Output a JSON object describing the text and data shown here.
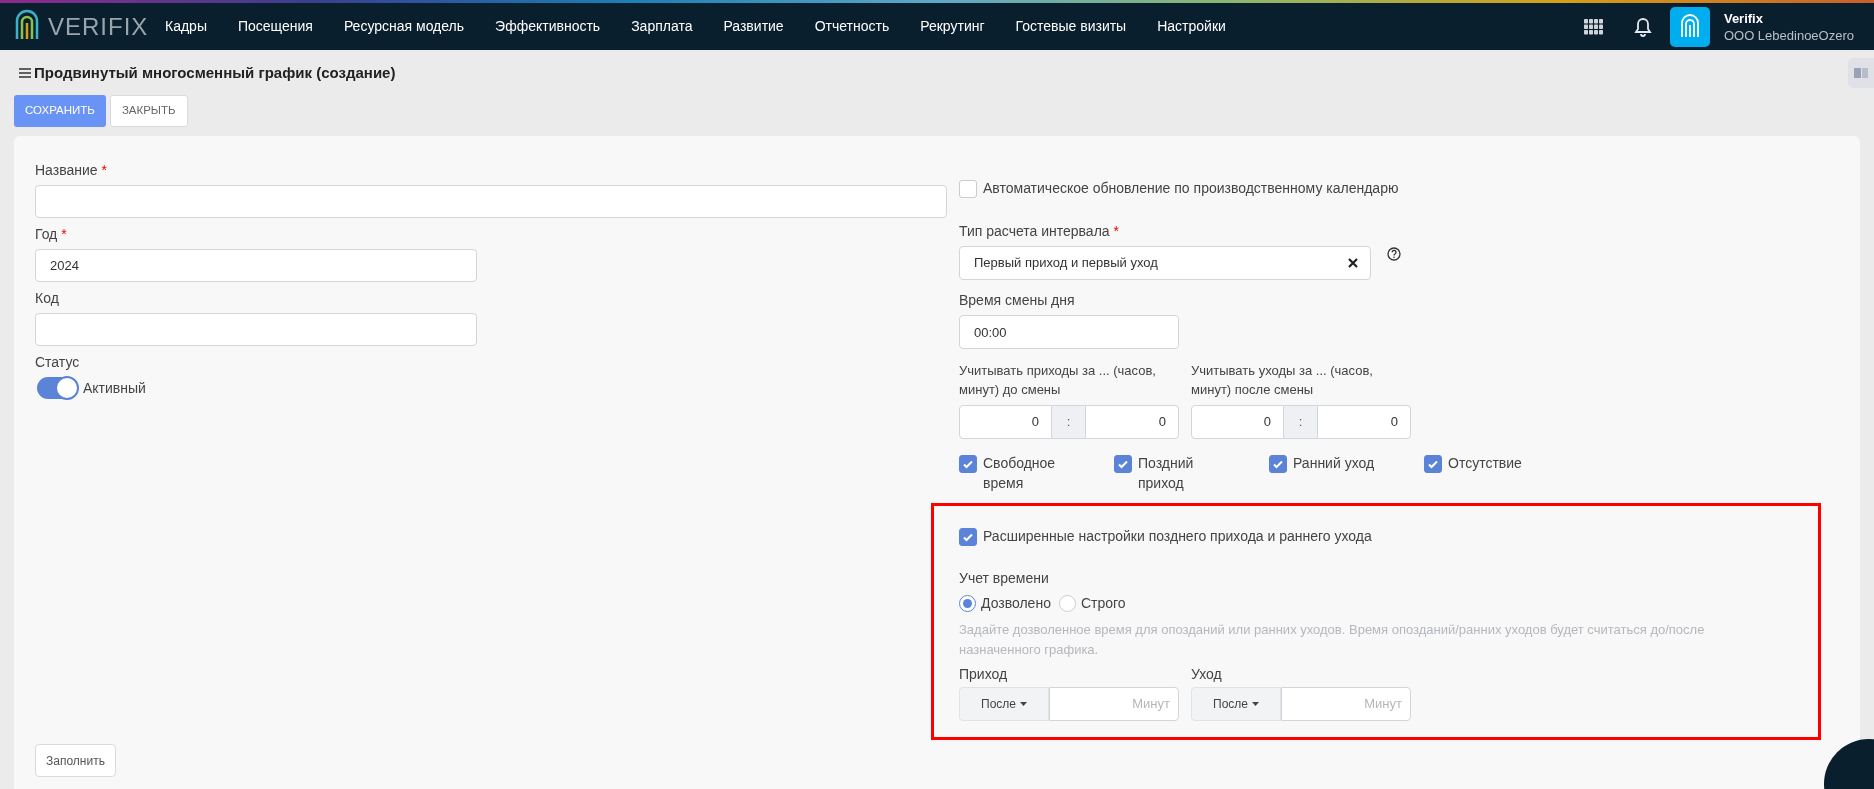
{
  "nav": {
    "logo": "VERIFIX",
    "menu": [
      "Кадры",
      "Посещения",
      "Ресурсная модель",
      "Эффективность",
      "Зарплата",
      "Развитие",
      "Отчетность",
      "Рекрутинг",
      "Гостевые визиты",
      "Настройки"
    ],
    "user": {
      "name": "Verifix",
      "org": "OOO LebedinoeOzero"
    }
  },
  "page": {
    "title": "Продвинутый многосменный график (создание)",
    "buttons": [
      {
        "label": "СОХРАНИТЬ",
        "kind": "primary"
      },
      {
        "label": "ЗАКРЫТЬ",
        "kind": "default"
      }
    ]
  },
  "left": {
    "fields": [
      {
        "label": "Название",
        "required_mark": "*"
      },
      {
        "label": "Год",
        "required_mark": "*",
        "value": "2024"
      },
      {
        "label": "Код"
      }
    ],
    "status": {
      "label": "Статус",
      "on": true,
      "text": "Активный"
    },
    "fill_button": "Заполнить"
  },
  "right": {
    "auto_update": {
      "label": "Автоматическое обновление по производственному календарю",
      "checked": false
    },
    "interval_type": {
      "label": "Тип расчета интервала",
      "required_mark": "*",
      "value": "Первый приход и первый уход"
    },
    "day_change": {
      "label": "Время смены дня",
      "value": "00:00"
    },
    "windows": [
      {
        "label": "Учитывать приходы за ... (часов, минут) до смены",
        "hours": "0",
        "separator": ":",
        "minutes": "0"
      },
      {
        "label": "Учитывать уходы за ... (часов, минут) после смены",
        "hours": "0",
        "separator": ":",
        "minutes": "0"
      }
    ],
    "flags": [
      {
        "label": "Свободное время",
        "checked": true
      },
      {
        "label": "Поздний приход",
        "checked": true
      },
      {
        "label": "Ранний уход",
        "checked": true
      },
      {
        "label": "Отсутствие",
        "checked": true
      }
    ],
    "advanced": {
      "label": "Расширенные настройки позднего прихода и раннего ухода",
      "checked": true,
      "time_accounting": {
        "label": "Учет времени",
        "options": [
          {
            "label": "Дозволено",
            "selected": true
          },
          {
            "label": "Строго",
            "selected": false
          }
        ]
      },
      "hint": "Задайте дозволенное время для опозданий или ранних уходов. Время опозданий/ранних уходов будет считаться до/после назначенного графика.",
      "limits": [
        {
          "label": "Приход",
          "mode": "После",
          "placeholder": "Минут"
        },
        {
          "label": "Уход",
          "mode": "После",
          "placeholder": "Минут"
        }
      ]
    }
  }
}
